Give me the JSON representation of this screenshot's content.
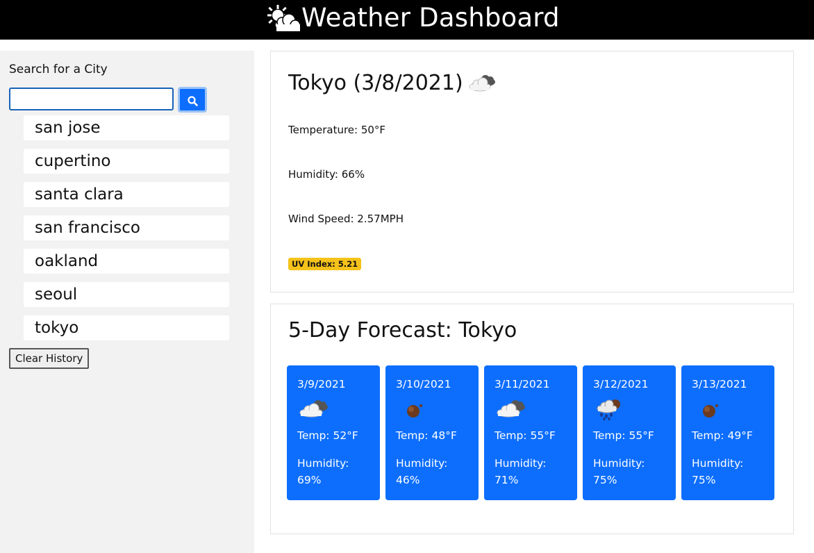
{
  "header": {
    "title": "Weather Dashboard",
    "icon": "sun-behind-cloud-icon"
  },
  "sidebar": {
    "search_label": "Search for a City",
    "search_value": "",
    "search_placeholder": "",
    "search_button_icon": "search-icon",
    "history": [
      "san jose",
      "cupertino",
      "santa clara",
      "san francisco",
      "oakland",
      "seoul",
      "tokyo"
    ],
    "clear_label": "Clear History"
  },
  "current": {
    "title": "Tokyo (3/8/2021)",
    "icon": "broken-clouds-icon",
    "temperature": "Temperature: 50°F",
    "humidity": "Humidity: 66%",
    "wind": "Wind Speed: 2.57MPH",
    "uv": "UV Index: 5.21"
  },
  "forecast": {
    "title": "5-Day Forecast: Tokyo",
    "days": [
      {
        "date": "3/9/2021",
        "icon": "broken-clouds-icon",
        "temp": "Temp: 52°F",
        "hum_label": "Humidity:",
        "hum_value": "69%"
      },
      {
        "date": "3/10/2021",
        "icon": "clear-night-icon",
        "temp": "Temp: 48°F",
        "hum_label": "Humidity:",
        "hum_value": "46%"
      },
      {
        "date": "3/11/2021",
        "icon": "broken-clouds-icon",
        "temp": "Temp: 55°F",
        "hum_label": "Humidity:",
        "hum_value": "71%"
      },
      {
        "date": "3/12/2021",
        "icon": "rain-night-icon",
        "temp": "Temp: 55°F",
        "hum_label": "Humidity:",
        "hum_value": "75%"
      },
      {
        "date": "3/13/2021",
        "icon": "clear-night-icon",
        "temp": "Temp: 49°F",
        "hum_label": "Humidity:",
        "hum_value": "75%"
      }
    ]
  },
  "colors": {
    "header_bg": "#000000",
    "sidebar_bg": "#f2f2f2",
    "forecast_card": "#0d6efd",
    "uv_badge": "#f5c21b"
  }
}
